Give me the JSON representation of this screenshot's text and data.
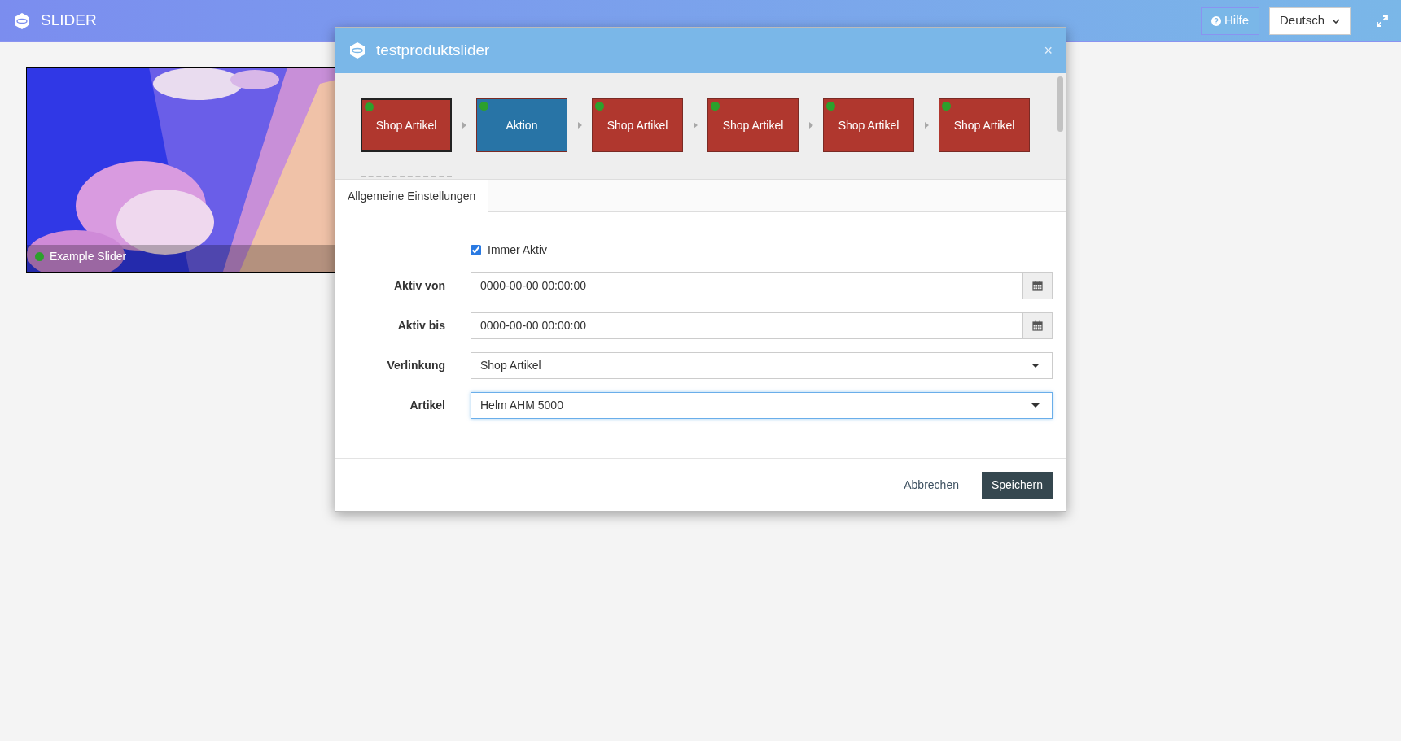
{
  "header": {
    "title": "SLIDER",
    "help_button": "Hilfe",
    "language": "Deutsch"
  },
  "sliders": [
    {
      "name": "Example Slider",
      "active": true
    }
  ],
  "dialog": {
    "title": "testproduktslider",
    "close": "×",
    "slides": [
      {
        "label": "Shop Artikel",
        "color": "#b0372e",
        "active": true,
        "selected": true
      },
      {
        "label": "Aktion",
        "color": "#2874a6",
        "active": true,
        "selected": false
      },
      {
        "label": "Shop Artikel",
        "color": "#b0372e",
        "active": true,
        "selected": false
      },
      {
        "label": "Shop Artikel",
        "color": "#b0372e",
        "active": true,
        "selected": false
      },
      {
        "label": "Shop Artikel",
        "color": "#b0372e",
        "active": true,
        "selected": false
      },
      {
        "label": "Shop Artikel",
        "color": "#b0372e",
        "active": true,
        "selected": false
      }
    ],
    "tabs": [
      {
        "label": "Allgemeine Einstellungen",
        "selected": true
      }
    ],
    "always_active": {
      "label": "Immer Aktiv",
      "checked": true
    },
    "fields": [
      {
        "kind": "date",
        "label": "Aktiv von",
        "value": "0000-00-00 00:00:00",
        "focused": false
      },
      {
        "kind": "date",
        "label": "Aktiv bis",
        "value": "0000-00-00 00:00:00",
        "focused": false
      },
      {
        "kind": "select",
        "label": "Verlinkung",
        "value": "Shop Artikel",
        "focused": false
      },
      {
        "kind": "select",
        "label": "Artikel",
        "value": "Helm AHM 5000",
        "focused": true
      }
    ],
    "buttons": [
      {
        "kind": "link",
        "label": "Abbrechen"
      },
      {
        "kind": "primary",
        "label": "Speichern"
      }
    ]
  }
}
